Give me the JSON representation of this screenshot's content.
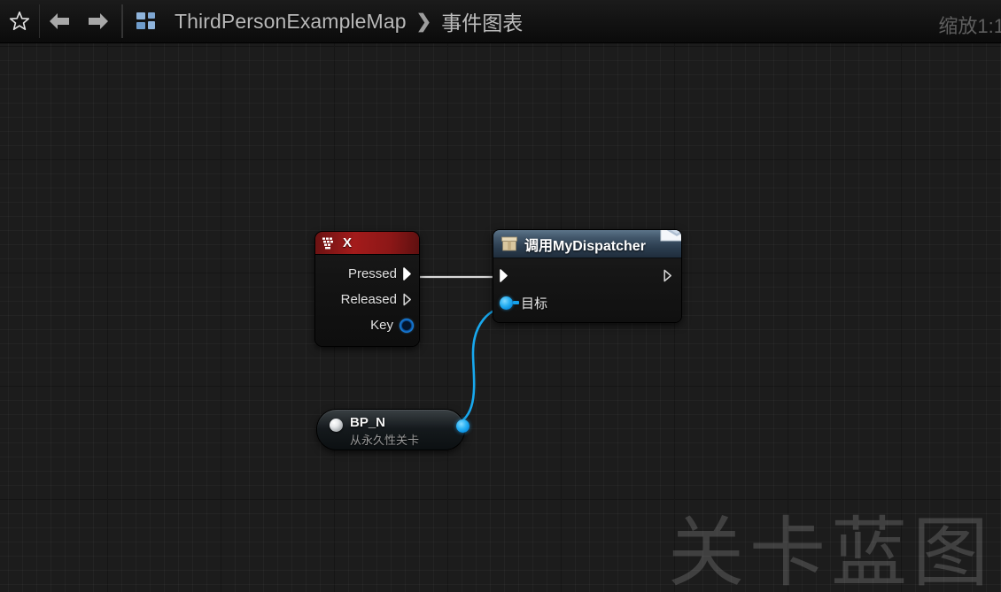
{
  "toolbar": {
    "favorite_icon": "star-icon",
    "back_icon": "arrow-left-icon",
    "forward_icon": "arrow-right-icon",
    "level_icon": "level-grid-icon",
    "breadcrumb_map": "ThirdPersonExampleMap",
    "breadcrumb_separator": "❯",
    "breadcrumb_graph": "事件图表",
    "zoom_label": "缩放1:1"
  },
  "canvas": {
    "watermark": "关卡蓝图",
    "background_color": "#1c1c1c",
    "grid_minor_color": "#262626",
    "grid_major_color": "#0d0d0d"
  },
  "nodes": {
    "key_event": {
      "title": "X",
      "header_color": "#a31b1b",
      "icon": "keyboard-icon",
      "pins": [
        {
          "label": "Pressed",
          "type": "exec",
          "connected": true
        },
        {
          "label": "Released",
          "type": "exec",
          "connected": false
        },
        {
          "label": "Key",
          "type": "struct",
          "connected": false
        }
      ]
    },
    "dispatcher": {
      "title": "调用MyDispatcher",
      "header_color": "#3b506a",
      "icon": "box-icon",
      "badge_icon": "envelope-icon",
      "exec_in": "",
      "exec_out": "",
      "target_label": "目标",
      "target_pin_color": "#18a8ee"
    },
    "actor_ref": {
      "title": "BP_N",
      "subtitle": "从永久性关卡",
      "icon": "sphere-icon",
      "out_pin_color": "#18a8ee"
    }
  },
  "wires": [
    {
      "name": "exec-wire",
      "from": "key_event.Pressed",
      "to": "dispatcher.exec_in",
      "color": "#d8d8d8"
    },
    {
      "name": "object-wire",
      "from": "actor_ref.out",
      "to": "dispatcher.target",
      "color": "#18a8ee"
    }
  ]
}
